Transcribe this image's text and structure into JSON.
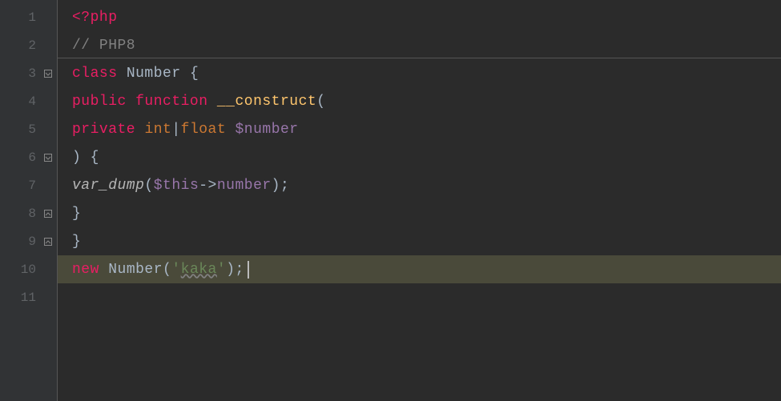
{
  "gutter": {
    "lines": [
      "1",
      "2",
      "3",
      "4",
      "5",
      "6",
      "7",
      "8",
      "9",
      "10",
      "11"
    ]
  },
  "code": {
    "l1": {
      "open": "<?",
      "php": "php"
    },
    "l2": {
      "comment": "// PHP8"
    },
    "l3": {
      "kw": "class",
      "name": " Number ",
      "brace": "{"
    },
    "l4": {
      "pub": "public",
      "sp1": " ",
      "fn": "function",
      "sp2": " ",
      "name": "__construct",
      "paren": "("
    },
    "l5": {
      "priv": "private",
      "sp1": " ",
      "t1": "int",
      "pipe": "|",
      "t2": "float",
      "sp2": " ",
      "var": "$number"
    },
    "l6": {
      "close": ") ",
      "brace": "{"
    },
    "l7": {
      "fn": "var_dump",
      "open": "(",
      "this": "$this",
      "arrow": "->",
      "prop": "number",
      "close": ");"
    },
    "l8": {
      "brace": "}"
    },
    "l9": {
      "brace": "}"
    },
    "l10": {
      "new": "new",
      "sp": " ",
      "cls": "Number(",
      "q1": "'",
      "str": "kaka",
      "q2": "'",
      "end": ");"
    }
  }
}
